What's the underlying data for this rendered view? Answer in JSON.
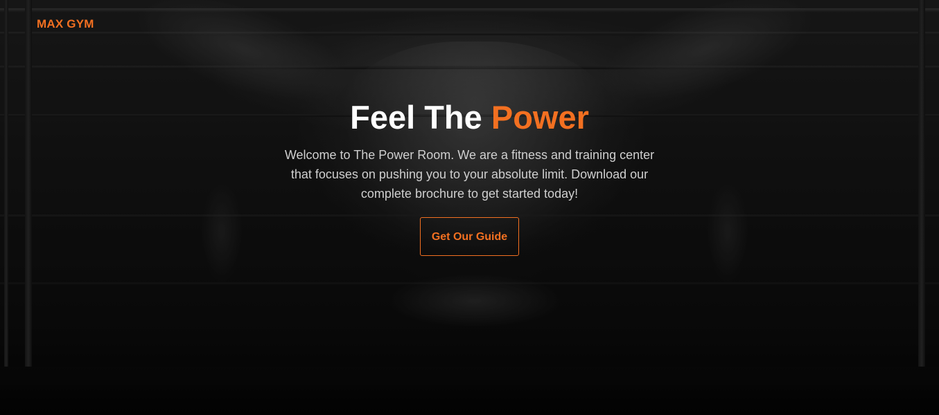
{
  "brand": {
    "name": "MAX GYM",
    "accent_color": "#f37021"
  },
  "hero": {
    "headline_start": "Feel The ",
    "headline_accent": "Power",
    "intro_line_1": "Welcome to The Power Room. We are a fitness and training center",
    "intro_line_2": "that focuses on pushing you to your absolute limit. Download our",
    "intro_line_3": "complete brochure to get started today!",
    "cta_label": "Get Our Guide"
  },
  "background": {
    "image_subject": "athlete-pull-up-photo"
  }
}
